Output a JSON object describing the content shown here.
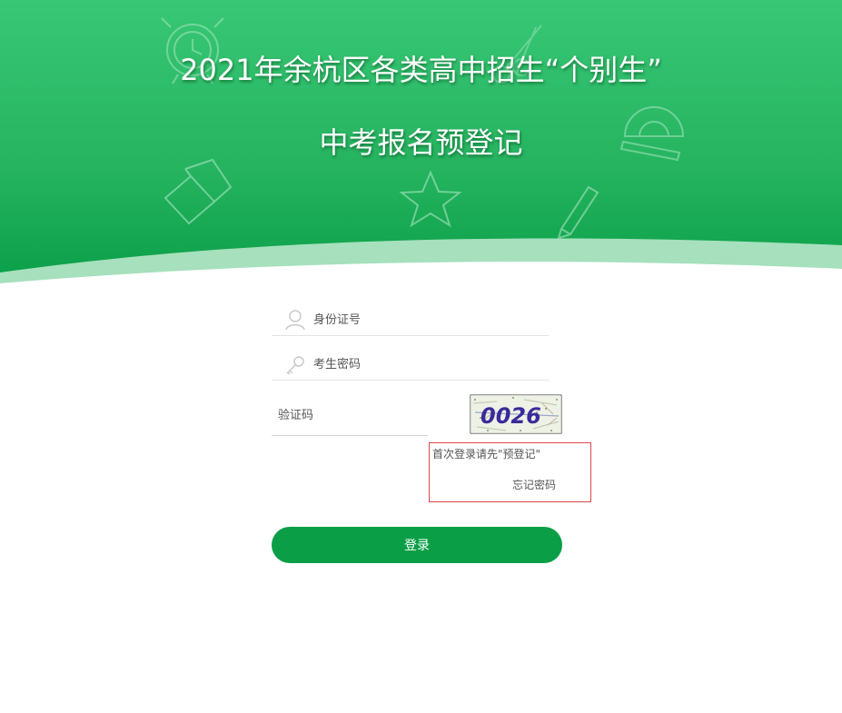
{
  "banner": {
    "title_line1": "2021年余杭区各类高中招生“个别生”",
    "title_line2": "中考报名预登记",
    "gradient_top": "#35c46f",
    "gradient_bottom": "#0a9e47"
  },
  "form": {
    "id_field": {
      "placeholder": "身份证号",
      "value": "",
      "icon": "user-icon"
    },
    "password_field": {
      "placeholder": "考生密码",
      "value": "",
      "icon": "key-icon"
    },
    "captcha_field": {
      "placeholder": "验证码",
      "value": ""
    },
    "captcha_image": {
      "text": "0026",
      "text_color": "#3a2a9a"
    },
    "links": {
      "first_login": "首次登录请先\"预登记\"",
      "forgot_password": "忘记密码",
      "box_color": "#d9474b"
    },
    "submit_label": "登录",
    "button_color": "#0a9e47"
  }
}
